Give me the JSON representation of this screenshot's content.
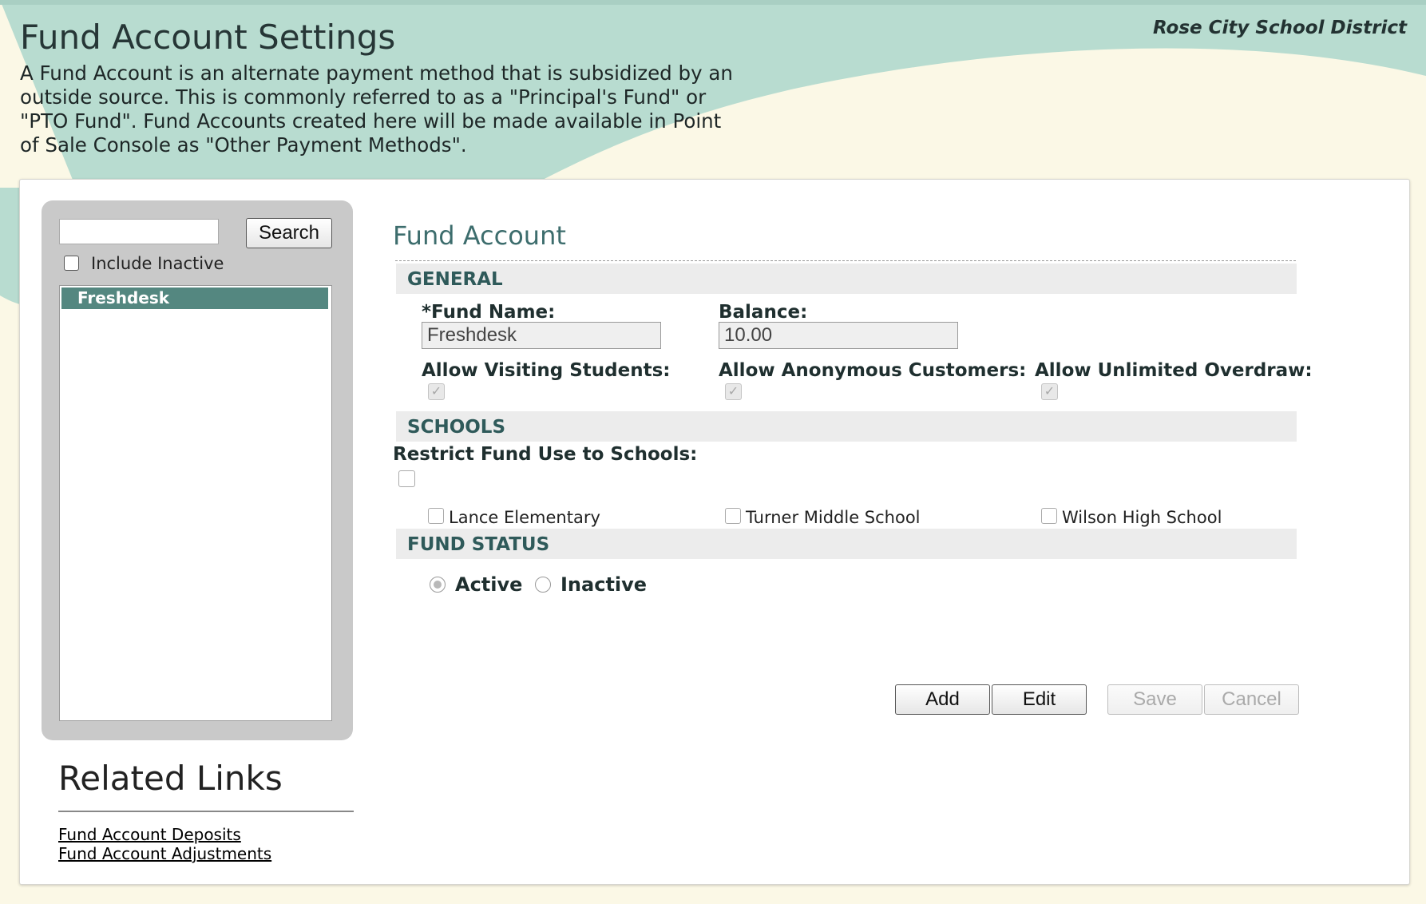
{
  "header": {
    "title": "Fund Account Settings",
    "district": "Rose City School District",
    "description": "A Fund Account is an alternate payment method that is subsidized by an outside source. This is commonly referred to as a \"Principal's Fund\" or \"PTO Fund\". Fund Accounts created here will be made available in Point of Sale Console as \"Other Payment Methods\"."
  },
  "search": {
    "input_value": "",
    "button_label": "Search",
    "include_inactive_label": "Include Inactive",
    "include_inactive_checked": false,
    "results": [
      "Freshdesk"
    ],
    "selected": "Freshdesk"
  },
  "related_links": {
    "title": "Related Links",
    "links": [
      "Fund Account Deposits",
      "Fund Account Adjustments"
    ]
  },
  "form": {
    "title": "Fund Account",
    "general": {
      "section_label": "GENERAL",
      "fund_name_label": "*Fund Name:",
      "fund_name_value": "Freshdesk",
      "balance_label": "Balance:",
      "balance_value": "10.00",
      "allow_visiting_label": "Allow Visiting Students:",
      "allow_visiting_checked": true,
      "allow_anonymous_label": "Allow Anonymous Customers:",
      "allow_anonymous_checked": true,
      "allow_overdraw_label": "Allow Unlimited Overdraw:",
      "allow_overdraw_checked": true
    },
    "schools": {
      "section_label": "SCHOOLS",
      "restrict_label": "Restrict Fund Use to Schools:",
      "restrict_checked": false,
      "items": [
        {
          "label": "Lance Elementary",
          "checked": false
        },
        {
          "label": "Turner Middle School",
          "checked": false
        },
        {
          "label": "Wilson High School",
          "checked": false
        }
      ]
    },
    "status": {
      "section_label": "FUND STATUS",
      "options": [
        "Active",
        "Inactive"
      ],
      "selected": "Active"
    },
    "buttons": {
      "add": "Add",
      "edit": "Edit",
      "save": "Save",
      "cancel": "Cancel"
    }
  },
  "colors": {
    "band_mint": "#b8dcd0",
    "background_cream": "#fbf8e6",
    "selected_item": "#548780",
    "heading_teal": "#3d6d6d"
  }
}
